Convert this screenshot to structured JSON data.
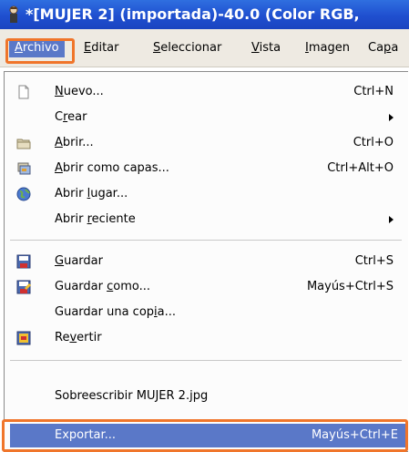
{
  "window": {
    "title": "*[MUJER 2] (importada)-40.0 (Color RGB, "
  },
  "menubar": {
    "items": [
      {
        "label": "Archivo"
      },
      {
        "label": "Editar"
      },
      {
        "label": "Seleccionar"
      },
      {
        "label": "Vista"
      },
      {
        "label": "Imagen"
      },
      {
        "label": "Capa"
      }
    ]
  },
  "menu": {
    "items": [
      {
        "label": "Nuevo...",
        "shortcut": "Ctrl+N",
        "icon": "new-document-icon"
      },
      {
        "label": "Crear",
        "shortcut": "",
        "submenu": true
      },
      {
        "label": "Abrir...",
        "shortcut": "Ctrl+O",
        "icon": "folder-icon"
      },
      {
        "label": "Abrir como capas...",
        "shortcut": "Ctrl+Alt+O",
        "icon": "layers-icon"
      },
      {
        "label": "Abrir lugar...",
        "shortcut": "",
        "icon": "globe-icon"
      },
      {
        "label": "Abrir reciente",
        "shortcut": "",
        "submenu": true
      },
      {
        "label": "Guardar",
        "shortcut": "Ctrl+S",
        "icon": "save-icon"
      },
      {
        "label": "Guardar como...",
        "shortcut": "Mayús+Ctrl+S",
        "icon": "save-as-icon"
      },
      {
        "label": "Guardar una copia...",
        "shortcut": ""
      },
      {
        "label": "Revertir",
        "shortcut": "",
        "icon": "revert-icon"
      },
      {
        "label": "Sobreescribir MUJER 2.jpg",
        "shortcut": ""
      },
      {
        "label": "Exportar...",
        "shortcut": "Mayús+Ctrl+E"
      }
    ]
  },
  "colors": {
    "highlight_border": "#f0752a",
    "selection": "#5a78c8",
    "titlebar": "#1f4fcf"
  }
}
